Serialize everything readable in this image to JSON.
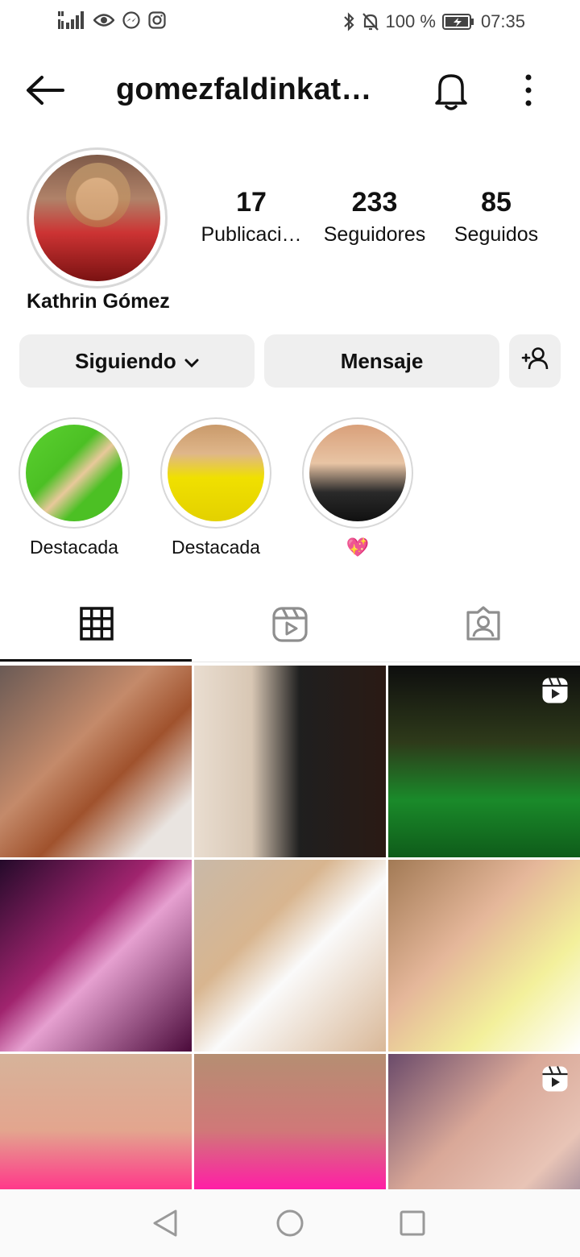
{
  "status_bar": {
    "battery_percent": "100 %",
    "time": "07:35",
    "left_icons": [
      "signal-icon",
      "eye-icon",
      "messenger-icon",
      "instagram-icon"
    ],
    "right_icons": [
      "bluetooth-icon",
      "mute-icon",
      "battery-icon"
    ]
  },
  "header": {
    "username": "gomezfaldinkath…",
    "back_icon": "arrow-left-icon",
    "notification_icon": "bell-icon",
    "menu_icon": "more-vertical-icon"
  },
  "profile": {
    "display_name": "Kathrin Gómez",
    "stats": [
      {
        "value": "17",
        "label": "Publicaci…"
      },
      {
        "value": "233",
        "label": "Seguidores"
      },
      {
        "value": "85",
        "label": "Seguidos"
      }
    ]
  },
  "actions": {
    "following_label": "Siguiendo",
    "message_label": "Mensaje",
    "add_user_icon": "add-person-icon"
  },
  "highlights": [
    {
      "label": "Destacada"
    },
    {
      "label": "Destacada"
    },
    {
      "label": "💖"
    }
  ],
  "tabs": [
    {
      "icon": "grid-icon",
      "active": true
    },
    {
      "icon": "reels-icon",
      "active": false
    },
    {
      "icon": "tagged-icon",
      "active": false
    }
  ],
  "posts": [
    {
      "type": "photo"
    },
    {
      "type": "photo"
    },
    {
      "type": "reel"
    },
    {
      "type": "photo"
    },
    {
      "type": "photo"
    },
    {
      "type": "photo"
    },
    {
      "type": "photo"
    },
    {
      "type": "photo"
    },
    {
      "type": "reel"
    }
  ],
  "navbar": {
    "icons": [
      "nav-back-icon",
      "nav-home-icon",
      "nav-recent-icon"
    ]
  },
  "colors": {
    "button_bg": "#efefef",
    "text": "#111111",
    "divider": "#e6e6e6"
  }
}
